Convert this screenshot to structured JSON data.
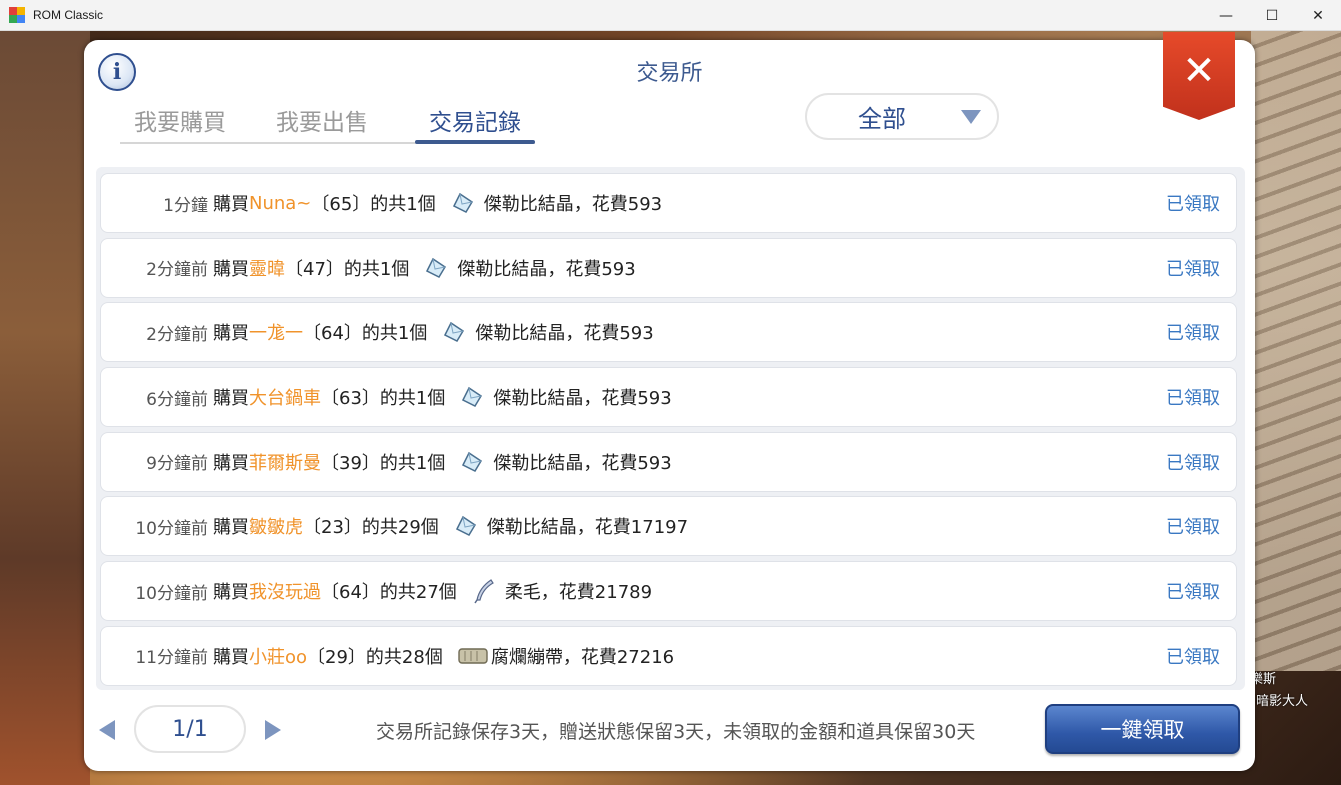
{
  "window": {
    "title": "ROM Classic",
    "minimize": "—",
    "maximize": "☐",
    "close": "✕"
  },
  "panel": {
    "title": "交易所",
    "info_icon": "i",
    "close_icon": "✕"
  },
  "tabs": [
    {
      "label": "我要購買",
      "active": false
    },
    {
      "label": "我要出售",
      "active": false
    },
    {
      "label": "交易記錄",
      "active": true
    }
  ],
  "filter": {
    "selected": "全部"
  },
  "records": [
    {
      "time": "1分鐘",
      "verb": "購買",
      "player": "Nuna~",
      "mid": "〔65〕的共1個",
      "icon": "crystal-icon",
      "item": "傑勒比結晶，花費593",
      "status": "已領取"
    },
    {
      "time": "2分鐘前",
      "verb": "購買",
      "player": "靈暐",
      "mid": "〔47〕的共1個",
      "icon": "crystal-icon",
      "item": "傑勒比結晶，花費593",
      "status": "已領取"
    },
    {
      "time": "2分鐘前",
      "verb": "購買",
      "player": "一尨一",
      "mid": "〔64〕的共1個",
      "icon": "crystal-icon",
      "item": "傑勒比結晶，花費593",
      "status": "已領取"
    },
    {
      "time": "6分鐘前",
      "verb": "購買",
      "player": "大台鍋車",
      "mid": "〔63〕的共1個",
      "icon": "crystal-icon",
      "item": "傑勒比結晶，花費593",
      "status": "已領取"
    },
    {
      "time": "9分鐘前",
      "verb": "購買",
      "player": "菲爾斯曼",
      "mid": "〔39〕的共1個",
      "icon": "crystal-icon",
      "item": "傑勒比結晶，花費593",
      "status": "已領取"
    },
    {
      "time": "10分鐘前",
      "verb": "購買",
      "player": "皺皺虎",
      "mid": "〔23〕的共29個",
      "icon": "crystal-icon",
      "item": "傑勒比結晶，花費17197",
      "status": "已領取"
    },
    {
      "time": "10分鐘前",
      "verb": "購買",
      "player": "我沒玩過",
      "mid": "〔64〕的共27個",
      "icon": "feather-icon",
      "item": "柔毛，花費21789",
      "status": "已領取"
    },
    {
      "time": "11分鐘前",
      "verb": "購買",
      "player": "小莊oo",
      "mid": "〔29〕的共28個",
      "icon": "bandage-icon",
      "item": "腐爛繃帶，花費27216",
      "status": "已領取"
    }
  ],
  "pager": {
    "label": "1/1"
  },
  "note": "交易所記錄保存3天，贈送狀態保留3天，未領取的金額和道具保留30天",
  "claim_all": "一鍵領取",
  "background_text": {
    "line1": "樂斯",
    "line2": "暗影大人"
  }
}
